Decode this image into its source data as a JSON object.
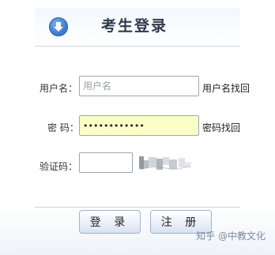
{
  "header": {
    "title": "考生登录",
    "icon": "download-arrow-icon"
  },
  "form": {
    "username": {
      "label": "用户名：",
      "value": "",
      "placeholder": "用户名",
      "recover_link": "用户名找回"
    },
    "password": {
      "label": "密  码：",
      "value": "••••••••••••",
      "recover_link": "密码找回"
    },
    "captcha": {
      "label": "验证码：",
      "value": ""
    }
  },
  "buttons": {
    "login": "登 录",
    "register": "注 册"
  },
  "watermark": "知乎 @中教文化",
  "colors": {
    "accent": "#3f7fcf",
    "password_bg": "#fbfdc6",
    "border": "#9aa7b6"
  }
}
